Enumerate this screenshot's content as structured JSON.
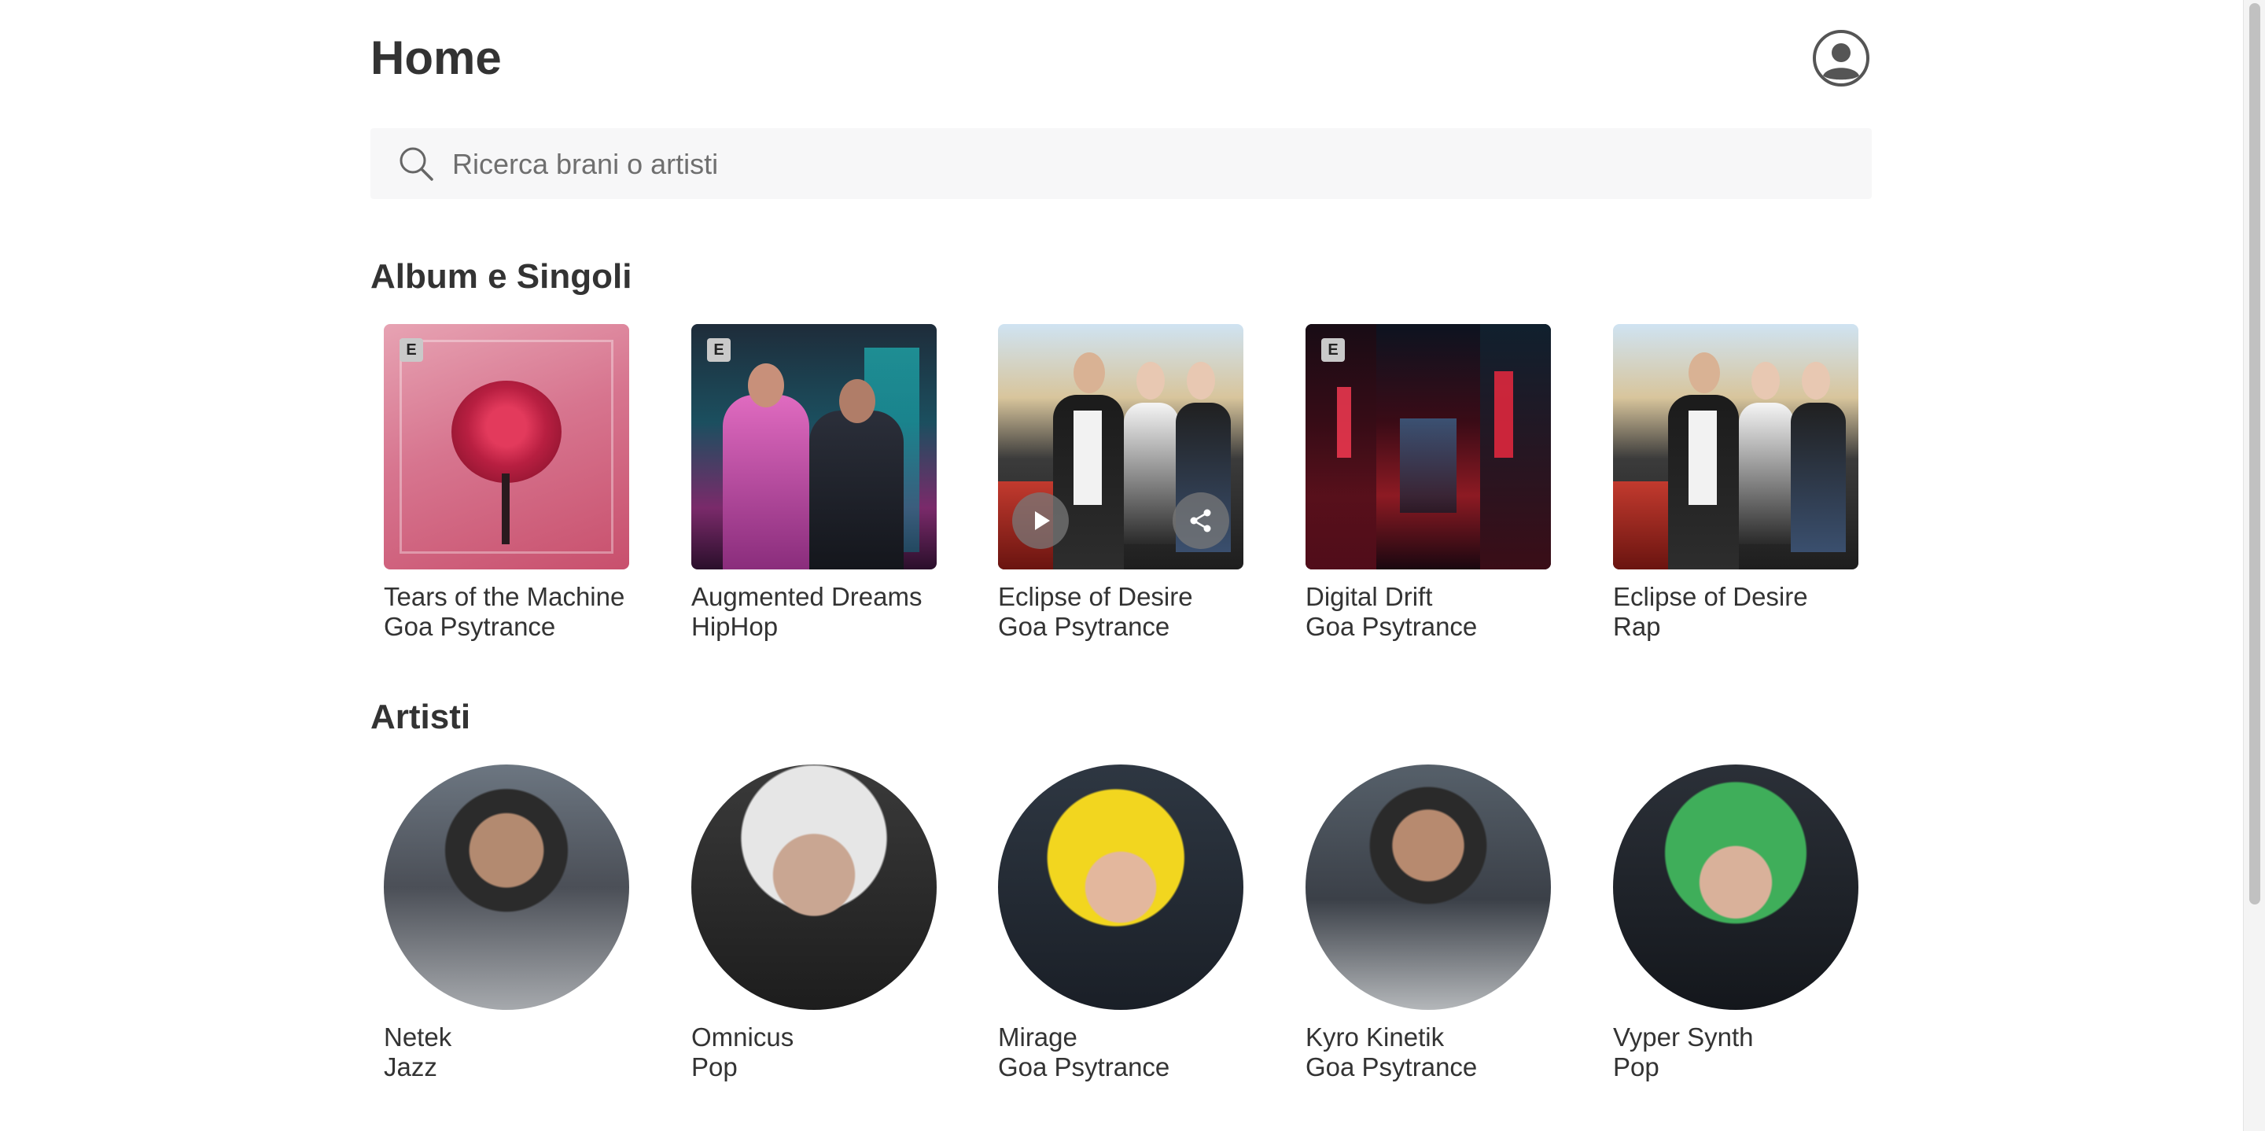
{
  "header": {
    "title": "Home"
  },
  "search": {
    "placeholder": "Ricerca brani o artisti",
    "icon": "search-icon"
  },
  "albums": {
    "title": "Album e Singoli",
    "items": [
      {
        "title": "Tears of the Machine",
        "genre": "Goa Psytrance",
        "explicit": "E"
      },
      {
        "title": "Augmented Dreams",
        "genre": "HipHop",
        "explicit": "E"
      },
      {
        "title": "Eclipse of Desire",
        "genre": "Goa Psytrance"
      },
      {
        "title": "Digital Drift",
        "genre": "Goa Psytrance",
        "explicit": "E"
      },
      {
        "title": "Eclipse of Desire",
        "genre": "Rap"
      }
    ]
  },
  "artists": {
    "title": "Artisti",
    "items": [
      {
        "name": "Netek",
        "genre": "Jazz"
      },
      {
        "name": "Omnicus",
        "genre": "Pop"
      },
      {
        "name": "Mirage",
        "genre": "Goa Psytrance"
      },
      {
        "name": "Kyro Kinetik",
        "genre": "Goa Psytrance"
      },
      {
        "name": "Vyper Synth",
        "genre": "Pop"
      }
    ]
  },
  "colors": {
    "text": "#333333",
    "search_bg": "#f7f7f8",
    "overlay": "#787878"
  }
}
